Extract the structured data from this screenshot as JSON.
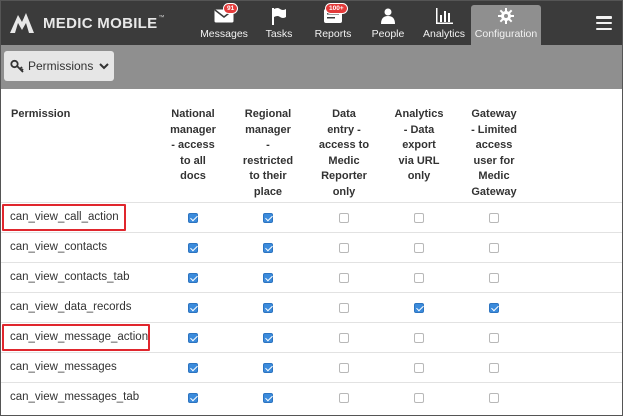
{
  "app": {
    "brand": "MEDIC MOBILE",
    "brand_tm": "™"
  },
  "nav": [
    {
      "label": "Messages",
      "icon": "envelope-icon",
      "badge": "91"
    },
    {
      "label": "Tasks",
      "icon": "flag-icon",
      "badge": ""
    },
    {
      "label": "Reports",
      "icon": "report-icon",
      "badge": "100+"
    },
    {
      "label": "People",
      "icon": "person-icon",
      "badge": ""
    },
    {
      "label": "Analytics",
      "icon": "bar-chart-icon",
      "badge": ""
    },
    {
      "label": "Configuration",
      "icon": "gear-icon",
      "badge": "",
      "active": true
    }
  ],
  "subbar": {
    "button_label": "Permissions"
  },
  "table": {
    "columns": [
      {
        "header": "Permission"
      },
      {
        "header_lines": [
          "National",
          "manager",
          "- access",
          "to all",
          "docs"
        ]
      },
      {
        "header_lines": [
          "Regional",
          "manager",
          "-",
          "restricted",
          "to their",
          "place"
        ]
      },
      {
        "header_lines": [
          "Data",
          "entry -",
          "access to",
          "Medic",
          "Reporter",
          "only"
        ]
      },
      {
        "header_lines": [
          "Analytics",
          "- Data",
          "export",
          "via URL",
          "only"
        ]
      },
      {
        "header_lines": [
          "Gateway",
          "- Limited",
          "access",
          "user for",
          "Medic",
          "Gateway"
        ]
      }
    ],
    "rows": [
      {
        "name": "can_view_call_action",
        "checks": [
          true,
          true,
          false,
          false,
          false
        ],
        "highlighted": true
      },
      {
        "name": "can_view_contacts",
        "checks": [
          true,
          true,
          false,
          false,
          false
        ],
        "highlighted": false
      },
      {
        "name": "can_view_contacts_tab",
        "checks": [
          true,
          true,
          false,
          false,
          false
        ],
        "highlighted": false
      },
      {
        "name": "can_view_data_records",
        "checks": [
          true,
          true,
          false,
          true,
          true
        ],
        "highlighted": false
      },
      {
        "name": "can_view_message_action",
        "checks": [
          true,
          true,
          false,
          false,
          false
        ],
        "highlighted": true
      },
      {
        "name": "can_view_messages",
        "checks": [
          true,
          true,
          false,
          false,
          false
        ],
        "highlighted": false
      },
      {
        "name": "can_view_messages_tab",
        "checks": [
          true,
          true,
          false,
          false,
          false
        ],
        "highlighted": false
      }
    ]
  },
  "colors": {
    "topbar": "#3b3b3b",
    "subbar": "#8f8f8f",
    "checkbox_on": "#3b8bdc",
    "highlight": "#e0262d",
    "badge": "#e33a3a"
  }
}
